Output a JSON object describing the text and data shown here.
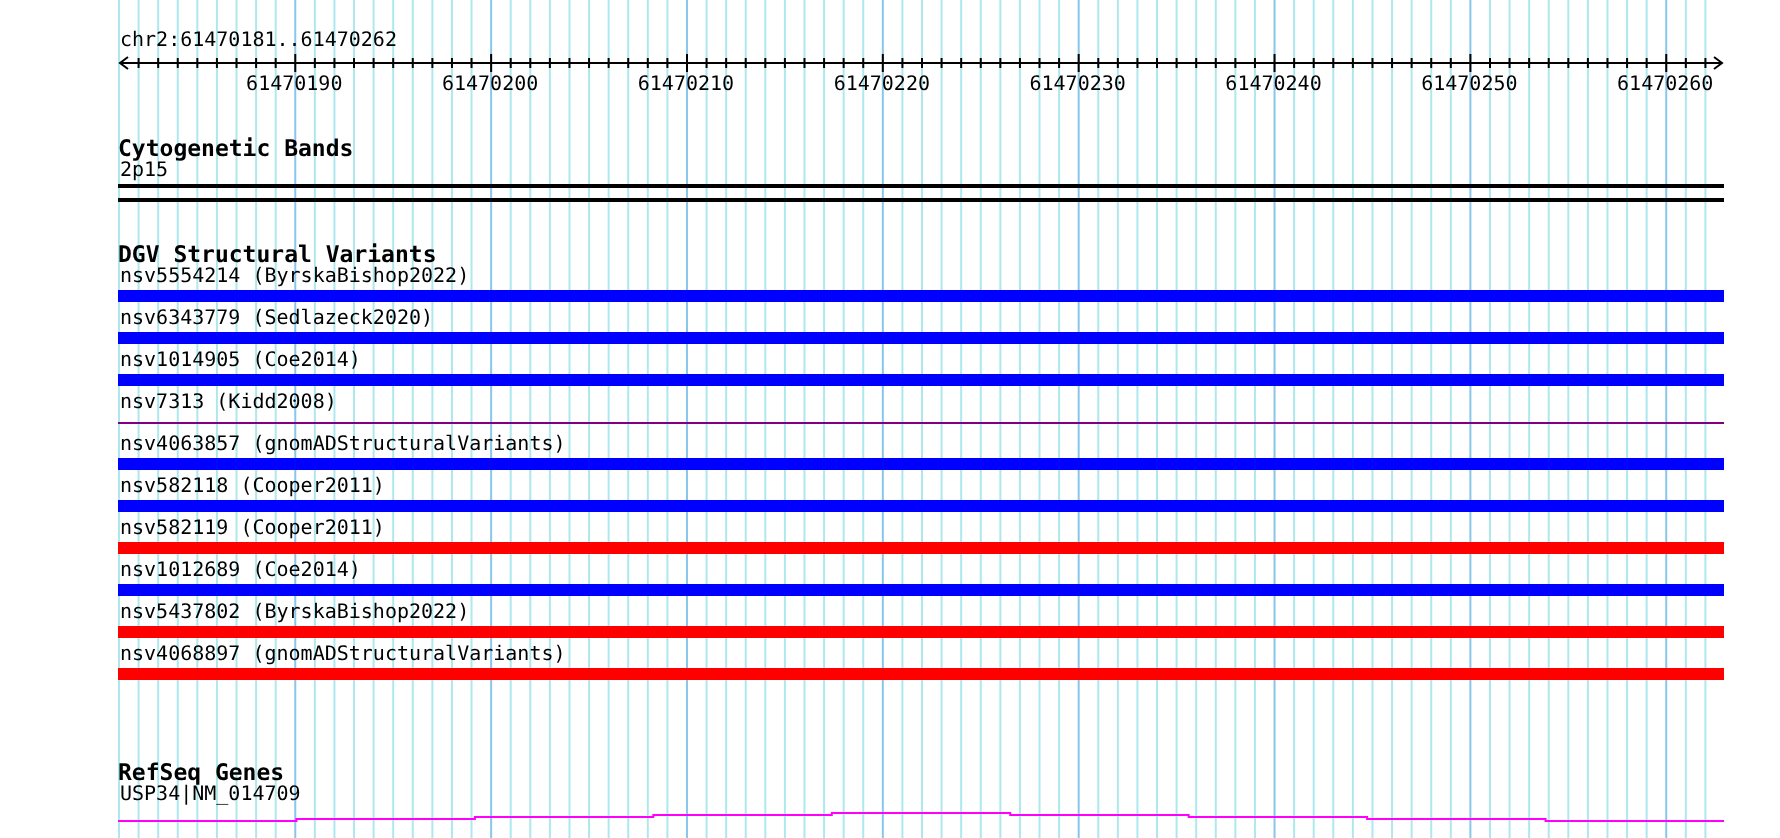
{
  "location": "chr2:61470181..61470262",
  "ruler": {
    "ticks": [
      "61470190",
      "61470200",
      "61470210",
      "61470220",
      "61470230",
      "61470240",
      "61470250",
      "61470260"
    ]
  },
  "cytogenetic_bands": {
    "title": "Cytogenetic Bands",
    "band": "2p15"
  },
  "dgv": {
    "title": "DGV Structural Variants",
    "variants": [
      {
        "label": "nsv5554214 (ByrskaBishop2022)",
        "kind": "bar",
        "color": "#0000ff"
      },
      {
        "label": "nsv6343779 (Sedlazeck2020)",
        "kind": "bar",
        "color": "#0000ff"
      },
      {
        "label": "nsv1014905 (Coe2014)",
        "kind": "bar",
        "color": "#0000ff"
      },
      {
        "label": "nsv7313 (Kidd2008)",
        "kind": "line",
        "color": "#800080"
      },
      {
        "label": "nsv4063857 (gnomADStructuralVariants)",
        "kind": "bar",
        "color": "#0000ff"
      },
      {
        "label": "nsv582118 (Cooper2011)",
        "kind": "bar",
        "color": "#0000ff"
      },
      {
        "label": "nsv582119 (Cooper2011)",
        "kind": "bar",
        "color": "#ff0000"
      },
      {
        "label": "nsv1012689 (Coe2014)",
        "kind": "bar",
        "color": "#0000ff"
      },
      {
        "label": "nsv5437802 (ByrskaBishop2022)",
        "kind": "bar",
        "color": "#ff0000"
      },
      {
        "label": "nsv4068897 (gnomADStructuralVariants)",
        "kind": "bar",
        "color": "#ff0000"
      }
    ]
  },
  "refseq": {
    "title": "RefSeq Genes",
    "gene": "USP34|NM_014709"
  }
}
